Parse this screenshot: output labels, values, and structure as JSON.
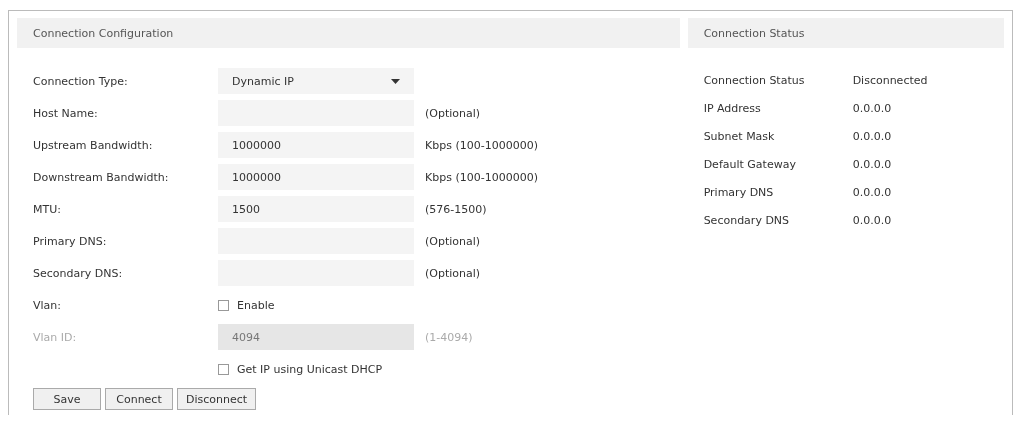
{
  "config": {
    "title": "Connection Configuration",
    "rows": [
      {
        "kind": "select",
        "label": "Connection Type:",
        "value": "Dynamic IP"
      },
      {
        "kind": "text",
        "label": "Host Name:",
        "hint": "(Optional)",
        "disabled": false
      },
      {
        "kind": "text",
        "label": "Upstream Bandwidth:",
        "value": "1000000",
        "hint": "Kbps (100-1000000)",
        "disabled": false
      },
      {
        "kind": "text",
        "label": "Downstream Bandwidth:",
        "value": "1000000",
        "hint": "Kbps (100-1000000)",
        "disabled": false
      },
      {
        "kind": "text",
        "label": "MTU:",
        "value": "1500",
        "hint": "(576-1500)",
        "disabled": false
      },
      {
        "kind": "text",
        "label": "Primary DNS:",
        "hint": "(Optional)",
        "disabled": false
      },
      {
        "kind": "text",
        "label": "Secondary DNS:",
        "hint": "(Optional)",
        "disabled": false
      },
      {
        "kind": "checkbox",
        "label": "Vlan:",
        "option": "Enable",
        "checked": false
      },
      {
        "kind": "text",
        "label": "Vlan ID:",
        "value": "4094",
        "hint": "(1-4094)",
        "disabled": true
      },
      {
        "kind": "checkbox",
        "option": "Get IP using Unicast DHCP",
        "checked": false
      }
    ],
    "buttons": [
      "Save",
      "Connect",
      "Disconnect"
    ]
  },
  "status": {
    "title": "Connection Status",
    "rows": [
      {
        "label": "Connection Status",
        "value": "Disconnected"
      },
      {
        "label": "IP Address",
        "value": "0.0.0.0"
      },
      {
        "label": "Subnet Mask",
        "value": "0.0.0.0"
      },
      {
        "label": "Default Gateway",
        "value": "0.0.0.0"
      },
      {
        "label": "Primary DNS",
        "value": "0.0.0.0"
      },
      {
        "label": "Secondary DNS",
        "value": "0.0.0.0"
      }
    ]
  }
}
